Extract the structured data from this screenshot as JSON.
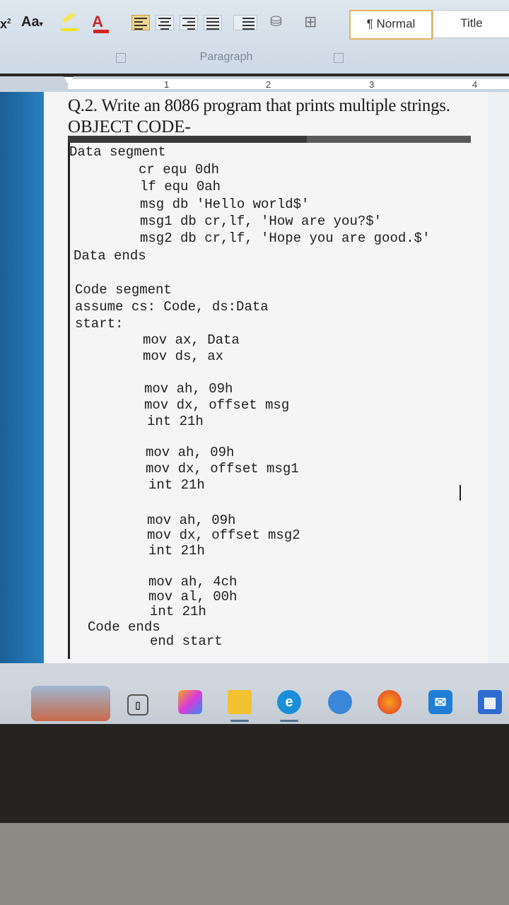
{
  "ribbon": {
    "font_size_btn": "x",
    "change_case_btn": "Aa",
    "font_color_btn": "A",
    "style_normal": "¶ Normal",
    "style_title": "Title",
    "group_label": "Paragraph"
  },
  "ruler": {
    "marks": [
      "1",
      "2",
      "3",
      "4"
    ]
  },
  "document": {
    "question": "Q.2. Write an 8086 program that prints multiple strings.",
    "heading": "OBJECT CODE-",
    "lines": {
      "data_seg": "Data segment",
      "cr": "cr equ 0dh",
      "lf": "lf equ 0ah",
      "msg": "msg db 'Hello world$'",
      "msg1": "msg1 db cr,lf, 'How are you?$'",
      "msg2": "msg2 db cr,lf, 'Hope you are good.$'",
      "data_ends": "Data ends",
      "code_seg": "Code segment",
      "assume": "assume cs: Code, ds:Data",
      "start": "start:",
      "mov_ax_data": "mov ax, Data",
      "mov_ds_ax": "mov ds, ax",
      "b1_ah": "mov ah, 09h",
      "b1_dx": "mov dx, offset msg",
      "b1_int": "int 21h",
      "b2_ah": "mov ah, 09h",
      "b2_dx": "mov dx, offset msg1",
      "b2_int": "int 21h",
      "b3_ah": "mov ah, 09h",
      "b3_dx": "mov dx, offset msg2",
      "b3_int": "int 21h",
      "ex_ah": "mov ah, 4ch",
      "ex_al": "mov al, 00h",
      "ex_int": "int 21h",
      "code_ends": "Code ends",
      "end_start": "end start"
    }
  },
  "taskbar": {
    "icons": [
      "task-view-icon",
      "copilot-icon",
      "file-explorer-icon",
      "edge-icon",
      "app-icon",
      "firefox-icon",
      "mail-icon",
      "store-icon"
    ]
  },
  "colors": {
    "accent_blue": "#2a7fbf",
    "page": "#f4f5f4",
    "ribbon": "#dfe7ef"
  }
}
